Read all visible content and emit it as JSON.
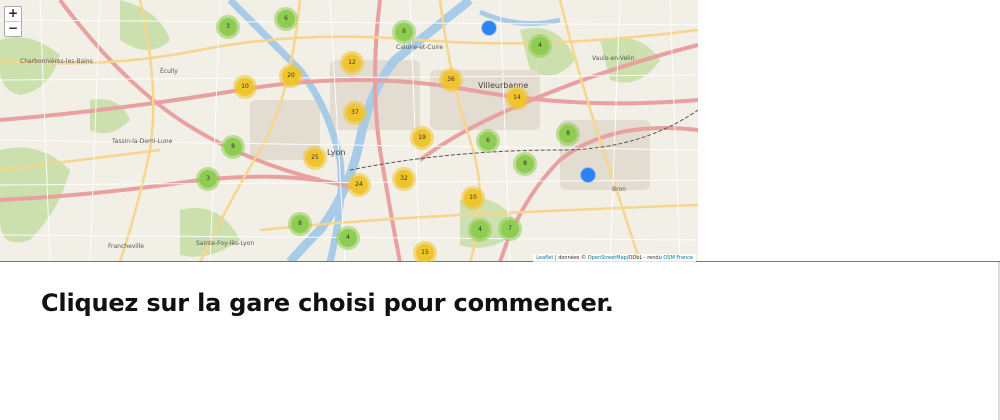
{
  "map": {
    "zoom_in": "+",
    "zoom_out": "−",
    "clusters": [
      {
        "label": "3",
        "color": "green"
      },
      {
        "label": "6",
        "color": "green"
      },
      {
        "label": "6",
        "color": "green"
      },
      {
        "label": "4",
        "color": "green"
      },
      {
        "label": "12",
        "color": "yellow"
      },
      {
        "label": "20",
        "color": "yellow"
      },
      {
        "label": "10",
        "color": "yellow"
      },
      {
        "label": "36",
        "color": "yellow"
      },
      {
        "label": "14",
        "color": "yellow"
      },
      {
        "label": "37",
        "color": "yellow"
      },
      {
        "label": "19",
        "color": "yellow"
      },
      {
        "label": "8",
        "color": "green"
      },
      {
        "label": "6",
        "color": "green"
      },
      {
        "label": "8",
        "color": "green"
      },
      {
        "label": "25",
        "color": "yellow"
      },
      {
        "label": "8",
        "color": "green"
      },
      {
        "label": "3",
        "color": "green"
      },
      {
        "label": "24",
        "color": "yellow"
      },
      {
        "label": "32",
        "color": "yellow"
      },
      {
        "label": "10",
        "color": "yellow"
      },
      {
        "label": "8",
        "color": "green"
      },
      {
        "label": "4",
        "color": "green"
      },
      {
        "label": "4",
        "color": "green"
      },
      {
        "label": "7",
        "color": "green"
      },
      {
        "label": "15",
        "color": "yellow"
      }
    ],
    "places": [
      "Villeurbanne",
      "Lyon",
      "Écully",
      "Charbonnières-les-Bains",
      "Tassin-la-Demi-Lune",
      "Francheville",
      "Sainte-Foy-lès-Lyon",
      "Vaulx-en-Velin",
      "Caluire-et-Cuire",
      "Bron"
    ],
    "attribution": {
      "leaflet": "Leaflet",
      "donnees": " | données © ",
      "osm": "OpenStreetMap",
      "odbl": "/ODbL - rendu ",
      "osmfr": "OSM France"
    },
    "colors": {
      "station": "#2b84f5",
      "cluster_small": "#8fcc52",
      "cluster_medium": "#f0c42c"
    }
  },
  "instruction": "Cliquez sur la gare choisi pour commencer."
}
